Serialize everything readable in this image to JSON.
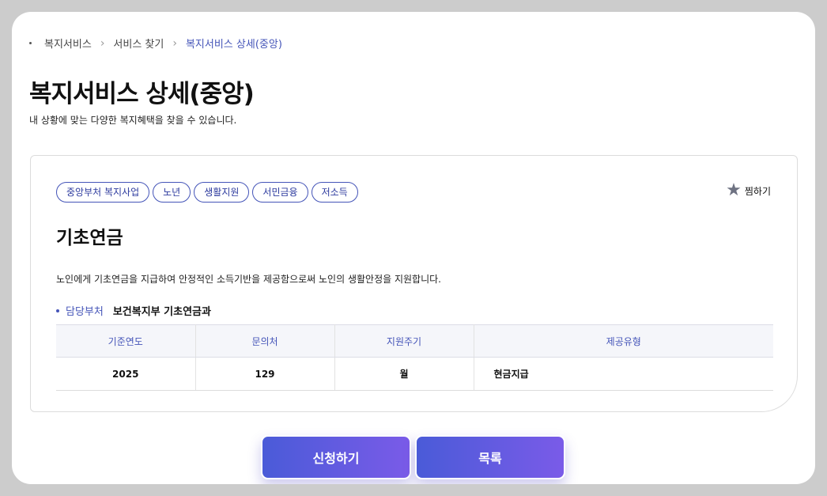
{
  "breadcrumb": {
    "items": [
      "복지서비스",
      "서비스 찾기"
    ],
    "current": "복지서비스 상세(중앙)"
  },
  "page": {
    "title": "복지서비스 상세(중앙)",
    "subtitle": "내 상황에 맞는 다양한 복지혜택을 찾을 수 있습니다."
  },
  "service": {
    "tags": [
      "중앙부처 복지사업",
      "노년",
      "생활지원",
      "서민금융",
      "저소득"
    ],
    "bookmark_label": "찜하기",
    "bookmark_icon": "star-icon",
    "title": "기초연금",
    "description": "노인에게 기초연금을 지급하여 안정적인 소득기반을 제공함으로써 노인의 생활안정을 지원합니다.",
    "dept_label": "담당부처",
    "dept_value": "보건복지부 기초연금과"
  },
  "table": {
    "headers": [
      "기준연도",
      "문의처",
      "지원주기",
      "제공유형"
    ],
    "row": [
      "2025",
      "129",
      "월",
      "현금지급"
    ]
  },
  "buttons": {
    "apply": "신청하기",
    "list": "목록"
  },
  "colors": {
    "accent": "#4454b8",
    "button_gradient_start": "#4a5bd8",
    "button_gradient_end": "#7a5be8",
    "background": "#cccccc"
  }
}
